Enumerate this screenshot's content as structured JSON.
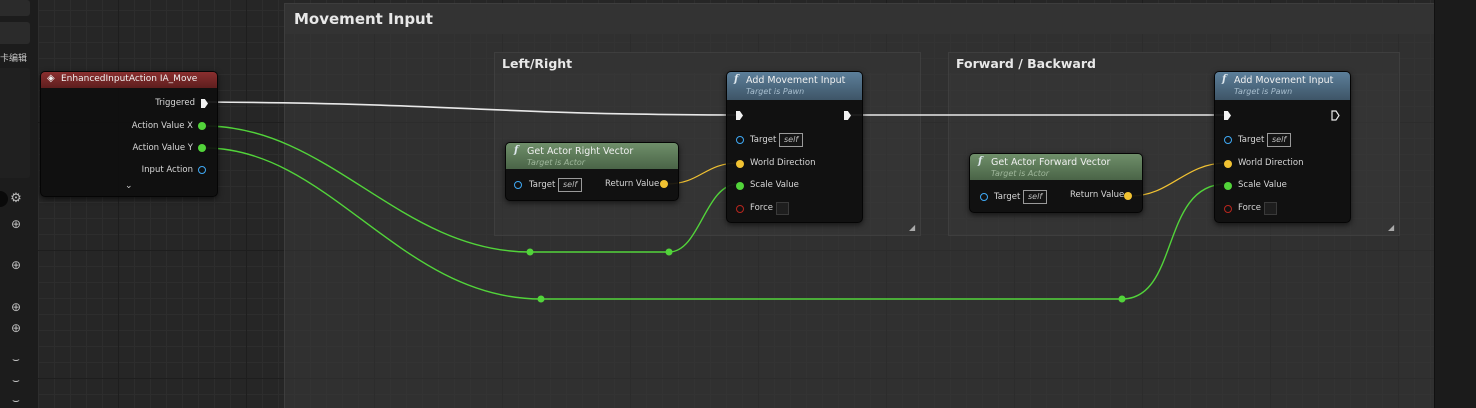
{
  "left_panel": {
    "label_fragment": "卡编辑",
    "gear_icon": "gear-icon",
    "add_icons": [
      "plus-circle-icon",
      "plus-circle-icon",
      "plus-circle-icon",
      "plus-circle-icon"
    ],
    "collapse_icons": [
      "chevron-down-icon",
      "chevron-down-icon",
      "chevron-down-icon"
    ]
  },
  "comments": {
    "movement": "Movement Input",
    "left_right": "Left/Right",
    "forward_backward": "Forward / Backward"
  },
  "event_node": {
    "title": "EnhancedInputAction IA_Move",
    "pins": {
      "triggered": "Triggered",
      "action_value_x": "Action Value X",
      "action_value_y": "Action Value Y",
      "input_action": "Input Action"
    }
  },
  "right_vector_node": {
    "title": "Get Actor Right Vector",
    "subtitle": "Target is Actor",
    "target_label": "Target",
    "target_value": "self",
    "return_label": "Return Value"
  },
  "forward_vector_node": {
    "title": "Get Actor Forward Vector",
    "subtitle": "Target is Actor",
    "target_label": "Target",
    "target_value": "self",
    "return_label": "Return Value"
  },
  "add_movement_1": {
    "title": "Add Movement Input",
    "subtitle": "Target is Pawn",
    "target_label": "Target",
    "target_value": "self",
    "world_direction": "World Direction",
    "scale_value": "Scale Value",
    "force": "Force"
  },
  "add_movement_2": {
    "title": "Add Movement Input",
    "subtitle": "Target is Pawn",
    "target_label": "Target",
    "target_value": "self",
    "world_direction": "World Direction",
    "scale_value": "Scale Value",
    "force": "Force"
  },
  "colors": {
    "exec_wire": "#ffffff",
    "float_wire": "#52d43a",
    "vector_wire": "#f1c232",
    "object_pin": "#3fa9f5",
    "bool_pin": "#b8261e",
    "event_header": "#8a2f2f",
    "function_header": "#5c7f9a",
    "pure_header": "#6f8f6a"
  }
}
